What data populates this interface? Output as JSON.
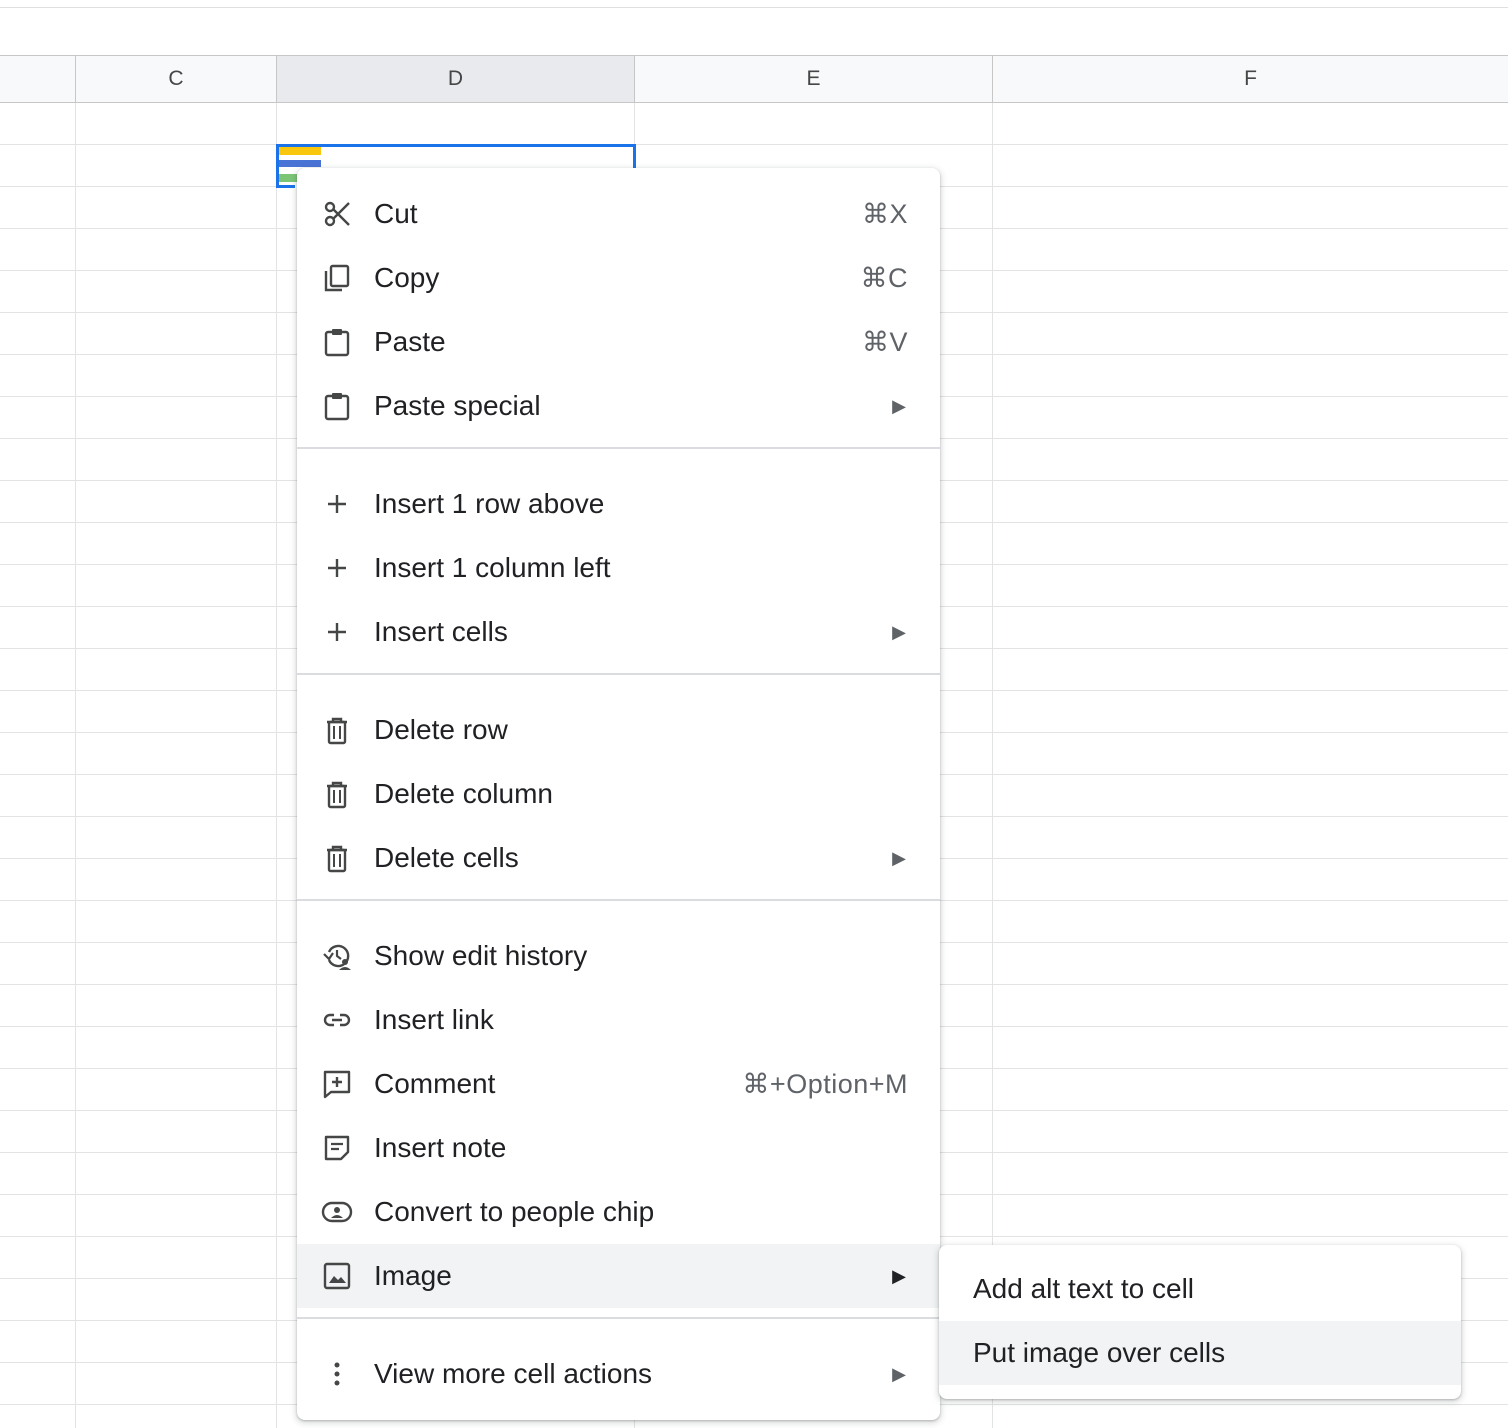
{
  "columns": [
    "C",
    "D",
    "E",
    "F"
  ],
  "selected_column": "D",
  "menu": {
    "groups": [
      [
        {
          "icon": "scissors-icon",
          "label": "Cut",
          "shortcut": "⌘X"
        },
        {
          "icon": "copy-icon",
          "label": "Copy",
          "shortcut": "⌘C"
        },
        {
          "icon": "clipboard-icon",
          "label": "Paste",
          "shortcut": "⌘V"
        },
        {
          "icon": "clipboard-icon",
          "label": "Paste special",
          "submenu": true
        }
      ],
      [
        {
          "icon": "plus-icon",
          "label": "Insert 1 row above"
        },
        {
          "icon": "plus-icon",
          "label": "Insert 1 column left"
        },
        {
          "icon": "plus-icon",
          "label": "Insert cells",
          "submenu": true
        }
      ],
      [
        {
          "icon": "trash-icon",
          "label": "Delete row"
        },
        {
          "icon": "trash-icon",
          "label": "Delete column"
        },
        {
          "icon": "trash-icon",
          "label": "Delete cells",
          "submenu": true
        }
      ],
      [
        {
          "icon": "history-icon",
          "label": "Show edit history"
        },
        {
          "icon": "link-icon",
          "label": "Insert link"
        },
        {
          "icon": "comment-icon",
          "label": "Comment",
          "shortcut": "⌘+Option+M"
        },
        {
          "icon": "note-icon",
          "label": "Insert note"
        },
        {
          "icon": "people-chip-icon",
          "label": "Convert to people chip"
        },
        {
          "icon": "image-icon",
          "label": "Image",
          "submenu": true,
          "highlighted": true
        }
      ],
      [
        {
          "icon": "more-vert-icon",
          "label": "View more cell actions",
          "submenu": true
        }
      ]
    ],
    "submenu_arrow": "▶"
  },
  "image_submenu": {
    "items": [
      {
        "label": "Add alt text to cell"
      },
      {
        "label": "Put image over cells",
        "highlighted": true
      }
    ]
  }
}
